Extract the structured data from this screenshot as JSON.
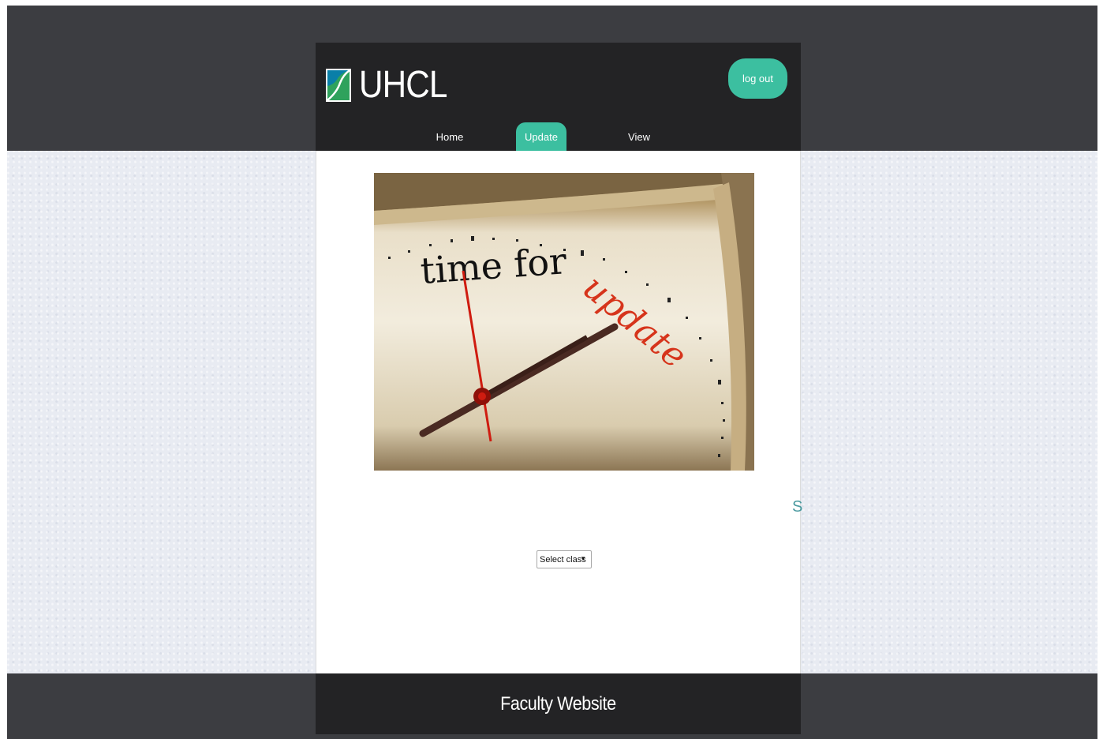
{
  "header": {
    "logo_text": "UHCL",
    "logout_label": "log out"
  },
  "nav": {
    "items": [
      {
        "label": "Home",
        "active": false
      },
      {
        "label": "Update",
        "active": true
      },
      {
        "label": "View",
        "active": false
      }
    ]
  },
  "hero": {
    "text_main": "time for",
    "text_accent": "update"
  },
  "main": {
    "side_text": "S",
    "select_value": "Select class"
  },
  "footer": {
    "title": "Faculty Website"
  },
  "colors": {
    "accent": "#3cbfa0",
    "header_bg": "#232325",
    "band_bg": "#3c3d41",
    "hero_accent": "#d6341b"
  }
}
